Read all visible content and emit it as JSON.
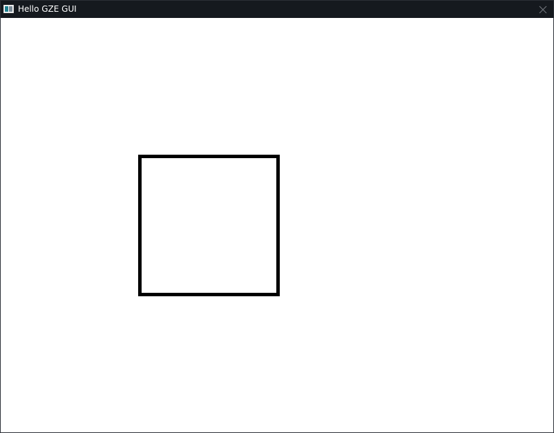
{
  "window": {
    "title": "Hello GZE GUI",
    "icon": "app-window-icon",
    "close_icon": "close-icon",
    "colors": {
      "titlebar": "#15191e",
      "title_text": "#ffffff",
      "canvas": "#ffffff",
      "shape_stroke": "#000000"
    }
  },
  "canvas": {
    "shape": "square-outline"
  }
}
